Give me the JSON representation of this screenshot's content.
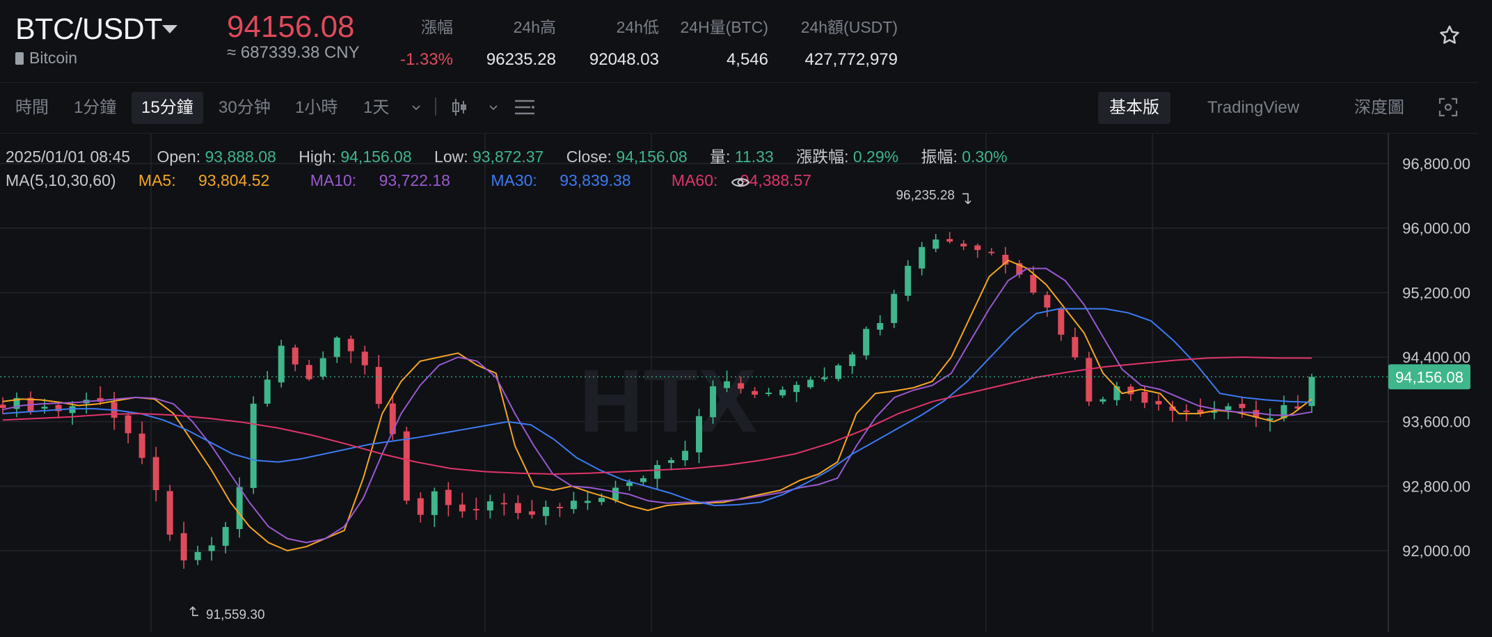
{
  "header": {
    "pair": "BTC/USDT",
    "coin_name": "Bitcoin",
    "last_price": "94156.08",
    "price_cny": "≈ 687339.38 CNY",
    "stats": [
      {
        "label": "漲幅",
        "value": "-1.33%",
        "tone": "negative"
      },
      {
        "label": "24h高",
        "value": "96235.28"
      },
      {
        "label": "24h低",
        "value": "92048.03"
      },
      {
        "label": "24H量(BTC)",
        "value": "4,546"
      },
      {
        "label": "24h額(USDT)",
        "value": "427,772,979"
      }
    ],
    "favorite_icon": "star-outline-icon"
  },
  "toolbar": {
    "intervals": [
      "時間",
      "1分鐘",
      "15分鐘",
      "30分钟",
      "1小時",
      "1天"
    ],
    "active_interval": "15分鐘",
    "icons": [
      "chevron-down-icon",
      "candle-type-icon",
      "chevron-down-icon",
      "indicator-settings-icon"
    ],
    "views": [
      "基本版",
      "TradingView",
      "深度圖"
    ],
    "active_view": "基本版",
    "fullscreen_icon": "fullscreen-icon"
  },
  "ohlc": {
    "date": "2025/01/01 08:45",
    "open_label": "Open:",
    "open": "93,888.08",
    "high_label": "High:",
    "high": "94,156.08",
    "low_label": "Low:",
    "low": "93,872.37",
    "close_label": "Close:",
    "close": "94,156.08",
    "volume_label": "量:",
    "volume": "11.33",
    "change_label": "漲跌幅:",
    "change": "0.29%",
    "amplitude_label": "振幅:",
    "amplitude": "0.30%"
  },
  "ma": {
    "title": "MA(5,10,30,60)",
    "ma5_label": "MA5:",
    "ma5": "93,804.52",
    "ma10_label": "MA10:",
    "ma10": "93,722.18",
    "ma30_label": "MA30:",
    "ma30": "93,839.38",
    "ma60_label": "MA60:",
    "ma60": "94,388.57"
  },
  "colors": {
    "up": "#3fb68b",
    "down": "#e04a5b",
    "ma5": "#f5a623",
    "ma10": "#9b59d0",
    "ma30": "#3d7bf2",
    "ma60": "#e0356a",
    "background": "#0f1115",
    "grid": "#22262c"
  },
  "watermark": "HTX",
  "chart_data": {
    "type": "line",
    "chart_type_shown": "candlestick",
    "interval": "15分鐘",
    "y_ticks": [
      "96,800.00",
      "96,000.00",
      "95,200.00",
      "94,400.00",
      "93,600.00",
      "92,800.00",
      "92,000.00"
    ],
    "ylim": [
      91300,
      97100
    ],
    "current_price_label": "94,156.08",
    "current_price": 94156.08,
    "high_marker": {
      "label": "96,235.28",
      "value": 96235.28
    },
    "low_marker": {
      "label": "91,559.30",
      "value": 91559.3
    },
    "candle_count": 95,
    "series": [
      {
        "name": "MA5",
        "values": [
          93850,
          93880,
          93870,
          93840,
          93800,
          93820,
          93860,
          93900,
          93880,
          93700,
          93350,
          93000,
          92600,
          92300,
          92100,
          92000,
          92050,
          92150,
          92250,
          92900,
          93700,
          94100,
          94350,
          94400,
          94450,
          94300,
          94200,
          93300,
          92800,
          92750,
          92800,
          92720,
          92650,
          92560,
          92500,
          92560,
          92580,
          92590,
          92600,
          92650,
          92700,
          92750,
          92870,
          92950,
          93100,
          93700,
          93950,
          93980,
          94020,
          94100,
          94400,
          94900,
          95400,
          95600,
          95500,
          95300,
          95000,
          94700,
          94200,
          93950,
          94000,
          93950,
          93700,
          93700,
          93740,
          93720,
          93660,
          93600,
          93700,
          93880
        ]
      },
      {
        "name": "MA10",
        "values": [
          93750,
          93800,
          93820,
          93830,
          93840,
          93860,
          93880,
          93900,
          93890,
          93820,
          93600,
          93300,
          92950,
          92600,
          92300,
          92150,
          92100,
          92150,
          92300,
          92650,
          93200,
          93700,
          94050,
          94300,
          94400,
          94350,
          94150,
          93700,
          93300,
          92950,
          92800,
          92780,
          92740,
          92700,
          92620,
          92590,
          92600,
          92600,
          92620,
          92640,
          92680,
          92720,
          92780,
          92820,
          92900,
          93300,
          93650,
          93900,
          93990,
          94050,
          94200,
          94600,
          95000,
          95350,
          95500,
          95500,
          95350,
          95050,
          94650,
          94250,
          94050,
          94000,
          93900,
          93800,
          93750,
          93720,
          93710,
          93680,
          93680,
          93720
        ]
      },
      {
        "name": "MA30",
        "values": [
          93700,
          93720,
          93740,
          93760,
          93760,
          93740,
          93700,
          93620,
          93500,
          93350,
          93200,
          93120,
          93100,
          93140,
          93200,
          93260,
          93320,
          93360,
          93400,
          93450,
          93500,
          93550,
          93600,
          93560,
          93380,
          93150,
          93000,
          92880,
          92800,
          92720,
          92620,
          92560,
          92570,
          92600,
          92700,
          92840,
          93000,
          93200,
          93360,
          93520,
          93680,
          93860,
          94100,
          94400,
          94700,
          94940,
          95000,
          95000,
          95000,
          94950,
          94850,
          94600,
          94300,
          93950,
          93900,
          93870,
          93850,
          93840
        ]
      },
      {
        "name": "MA60",
        "values": [
          93620,
          93640,
          93660,
          93690,
          93700,
          93680,
          93640,
          93590,
          93520,
          93430,
          93320,
          93200,
          93100,
          93020,
          92980,
          92960,
          92950,
          92960,
          92980,
          93000,
          93020,
          93060,
          93120,
          93200,
          93330,
          93500,
          93700,
          93850,
          93950,
          94050,
          94150,
          94220,
          94280,
          94320,
          94360,
          94390,
          94400,
          94390,
          94388
        ]
      }
    ]
  }
}
